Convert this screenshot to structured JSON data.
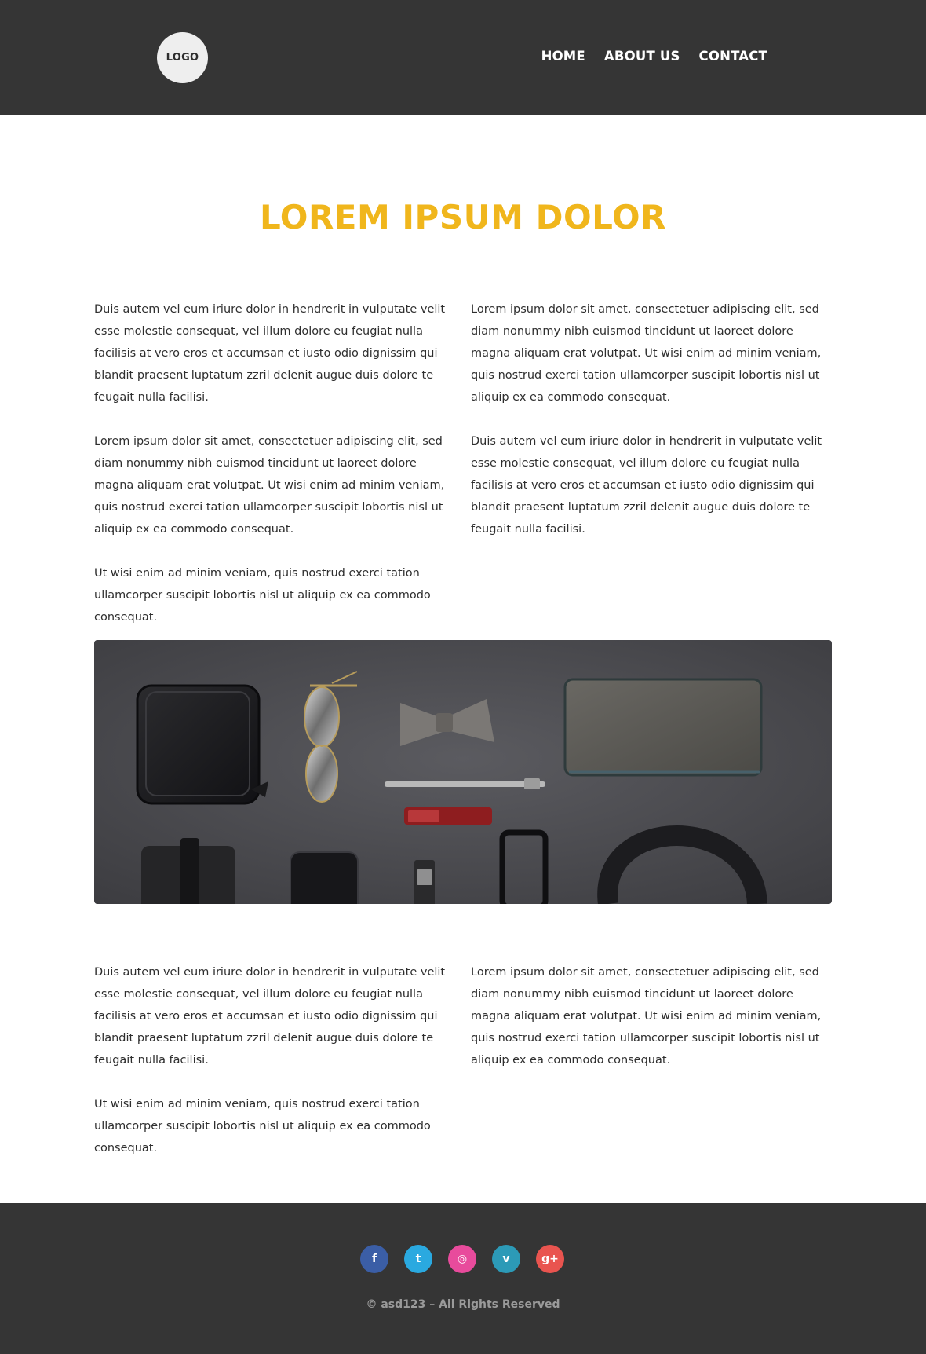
{
  "header": {
    "logo_text": "LOGO",
    "nav": [
      {
        "label": "HOME"
      },
      {
        "label": "ABOUT US"
      },
      {
        "label": "CONTACT"
      }
    ]
  },
  "main": {
    "title": "LOREM IPSUM DOLOR",
    "section1": {
      "left": [
        "Duis autem vel eum iriure dolor in hendrerit in vulputate velit esse molestie consequat, vel illum dolore eu feugiat nulla facilisis at vero eros et accumsan et iusto odio dignissim qui blandit praesent luptatum zzril delenit augue duis dolore te feugait nulla facilisi.",
        "Lorem ipsum dolor sit amet, consectetuer adipiscing elit, sed diam nonummy nibh euismod tincidunt ut laoreet dolore magna aliquam erat volutpat. Ut wisi enim ad minim veniam, quis nostrud exerci tation ullamcorper suscipit lobortis nisl ut aliquip ex ea commodo consequat.",
        "Ut wisi enim ad minim veniam, quis nostrud exerci tation ullamcorper suscipit lobortis nisl ut aliquip ex ea commodo consequat."
      ],
      "right": [
        "Lorem ipsum dolor sit amet, consectetuer adipiscing elit, sed diam nonummy nibh euismod tincidunt ut laoreet dolore magna aliquam erat volutpat. Ut wisi enim ad minim veniam, quis nostrud exerci tation ullamcorper suscipit lobortis nisl ut aliquip ex ea commodo consequat.",
        "Duis autem vel eum iriure dolor in hendrerit in vulputate velit esse molestie consequat, vel illum dolore eu feugiat nulla facilisis at vero eros et accumsan et iusto odio dignissim qui blandit praesent luptatum zzril delenit augue duis dolore te feugait nulla facilisi."
      ]
    },
    "section2": {
      "left": [
        "Duis autem vel eum iriure dolor in hendrerit in vulputate velit esse molestie consequat, vel illum dolore eu feugiat nulla facilisis at vero eros et accumsan et iusto odio dignissim qui blandit praesent luptatum zzril delenit augue duis dolore te feugait nulla facilisi.",
        "Ut wisi enim ad minim veniam, quis nostrud exerci tation ullamcorper suscipit lobortis nisl ut aliquip ex ea commodo consequat."
      ],
      "right": [
        "Lorem ipsum dolor sit amet, consectetuer adipiscing elit, sed diam nonummy nibh euismod tincidunt ut laoreet dolore magna aliquam erat volutpat. Ut wisi enim ad minim veniam, quis nostrud exerci tation ullamcorper suscipit lobortis nisl ut aliquip ex ea commodo consequat."
      ]
    }
  },
  "footer": {
    "socials": [
      {
        "name": "facebook-icon",
        "glyph": "f",
        "color": "#3b5ea6"
      },
      {
        "name": "twitter-icon",
        "glyph": "t",
        "color": "#2aa9e0"
      },
      {
        "name": "dribbble-icon",
        "glyph": "◎",
        "color": "#e84b9c"
      },
      {
        "name": "vimeo-icon",
        "glyph": "v",
        "color": "#2c9ab7"
      },
      {
        "name": "google-plus-icon",
        "glyph": "g+",
        "color": "#e9544f"
      }
    ],
    "copyright": "© asd123 – All Rights Reserved"
  },
  "colors": {
    "header_bg": "#353535",
    "accent": "#f0b61c",
    "footer_bg": "#353535"
  }
}
